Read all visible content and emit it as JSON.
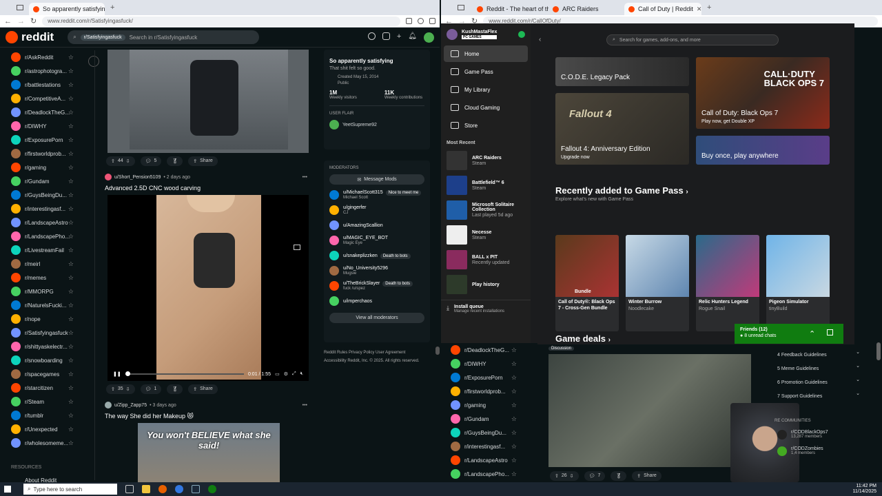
{
  "left_browser": {
    "active_tab": "So apparently satisfying",
    "url": "www.reddit.com/r/Satisfyingasfuck/"
  },
  "right_browser": {
    "tabs": [
      {
        "label": "Reddit - The heart of the intern"
      },
      {
        "label": "ARC Raiders"
      },
      {
        "label": "Call of Duty | Reddit"
      }
    ],
    "url": "www.reddit.com/r/CallOfDuty/"
  },
  "reddit": {
    "logo": "reddit",
    "search_chip": "r/Satisfyingasfuck",
    "search_placeholder": "Search in r/Satisfyingasfuck",
    "sidebar": [
      "r/AskReddit",
      "r/astrophotogra...",
      "r/battlestations",
      "r/CompetitiveA...",
      "r/DeadlockTheG...",
      "r/DIWHY",
      "r/ExposurePorn",
      "r/firstworldprob...",
      "r/gaming",
      "r/Gundam",
      "r/GuysBeingDu...",
      "r/interestingasf...",
      "r/LandscapeAstro",
      "r/LandscapePho...",
      "r/LivestreamFail",
      "r/meirl",
      "r/memes",
      "r/MMORPG",
      "r/NaturelsFucki...",
      "r/nope",
      "r/Satisfyingasfuck",
      "r/shittyaskelectr...",
      "r/snowboarding",
      "r/spacegames",
      "r/starcitizen",
      "r/Steam",
      "r/tumblr",
      "r/Unexpected",
      "r/wholesomeme..."
    ],
    "resources_label": "RESOURCES",
    "about_label": "About Reddit",
    "post1": {
      "votes": "44",
      "comments": "5",
      "share": "Share"
    },
    "post2": {
      "author": "u/Short_Pension5109",
      "age": "• 2 days ago",
      "title": "Advanced 2.5D CNC wood carving",
      "time": "0:01 / 1:55",
      "votes": "35",
      "comments": "1",
      "share": "Share"
    },
    "post3": {
      "author": "u/Zipp_Zapp75",
      "age": "• 3 days ago",
      "title": "The way She did her Makeup 😻",
      "caption": "You won't BELIEVE what she said!"
    },
    "community": {
      "name": "So apparently satisfying",
      "tagline": "That shit felt so good.",
      "created": "Created May 15, 2014",
      "visibility": "Public",
      "visitors": "1M",
      "visitors_label": "Weekly visitors",
      "contrib": "11K",
      "contrib_label": "Weekly contributions",
      "flair_label": "USER FLAIR",
      "flair_user": "YeetSupreme92"
    },
    "mods_label": "MODERATORS",
    "message_mods": "Message Mods",
    "mods": [
      {
        "name": "u/MichaelScott315",
        "sub": "Michael Scott",
        "flair": "Nice to meet me"
      },
      {
        "name": "u/gingerfer",
        "sub": "CJ",
        "flair": ""
      },
      {
        "name": "u/AmazingScallion",
        "sub": "",
        "flair": ""
      },
      {
        "name": "u/MAGIC_EYE_BOT",
        "sub": "Magic Eye",
        "flair": ""
      },
      {
        "name": "u/snakeplizzken",
        "sub": "",
        "flair": "Death to bots"
      },
      {
        "name": "u/No_University5296",
        "sub": "Mugsie",
        "flair": ""
      },
      {
        "name": "u/TheBrickSlayer",
        "sub": "fuck /u/spez",
        "flair": "Death to bots"
      },
      {
        "name": "u/imperchaos",
        "sub": "",
        "flair": ""
      }
    ],
    "view_all": "View all moderators",
    "footer1": "Reddit Rules  Privacy Policy  User Agreement",
    "footer2": "Accessibility  Reddit, Inc. © 2025. All rights reserved."
  },
  "xbox": {
    "user": "KushMastaFlex",
    "badge": "PC GAMES",
    "search": "Search for games, add-ons, and more",
    "nav": [
      "Home",
      "Game Pass",
      "My Library",
      "Cloud Gaming",
      "Store"
    ],
    "most_recent": "Most Recent",
    "recent": [
      {
        "t": "ARC Raiders",
        "s": "Steam"
      },
      {
        "t": "Battlefield™ 6",
        "s": "Steam"
      },
      {
        "t": "Microsoft Solitaire Collection",
        "s": "Last played 5d ago"
      },
      {
        "t": "Necesse",
        "s": "Steam"
      },
      {
        "t": "BALL x PIT",
        "s": "Recently updated"
      },
      {
        "t": "Play history",
        "s": ""
      }
    ],
    "install_queue": "Install queue",
    "install_sub": "Manage recent installations",
    "hero": {
      "cod_legacy": "C.O.D.E. Legacy Pack",
      "bo7_title": "Call of Duty: Black Ops 7",
      "bo7_sub": "Play now, get Double XP",
      "fallout_title": "Fallout 4: Anniversary Edition",
      "fallout_sub": "Upgrade now",
      "buy_once": "Buy once, play anywhere"
    },
    "recently_added": "Recently added to Game Pass",
    "recently_sub": "Explore what's new with Game Pass",
    "games": [
      {
        "t": "Call of Duty®: Black Ops 7 - Cross-Gen Bundle",
        "s": "Bundle"
      },
      {
        "t": "Winter Burrow",
        "s": "Noodlecake"
      },
      {
        "t": "Relic Hunters Legend",
        "s": "Rogue Snail"
      },
      {
        "t": "Pigeon Simulator",
        "s": "tinyBuild"
      }
    ],
    "deals": "Game deals",
    "friends": "Friends (12)",
    "unread": "8 unread chats"
  },
  "right_reddit": {
    "sidebar": [
      "r/DeadlockTheG...",
      "r/DIWHY",
      "r/ExposurePorn",
      "r/firstworldprob...",
      "r/gaming",
      "r/Gundam",
      "r/GuysBeingDu...",
      "r/interestingasf...",
      "r/LandscapeAstro",
      "r/LandscapePho..."
    ],
    "discussion": "Discussion",
    "votes": "26",
    "comments": "7",
    "share": "Share",
    "rules": [
      "4  Feedback Guidelines",
      "5  Meme Guidelines",
      "6  Promotion Guidelines",
      "7  Support Guidelines"
    ],
    "communities_label": "RE COMMUNITIES",
    "communities": [
      {
        "n": "r/CODBlackOps7",
        "m": "13,287 members"
      },
      {
        "n": "r/CODZombies",
        "m": "1,4 members"
      }
    ]
  },
  "taskbar": {
    "search": "Type here to search",
    "time": "11:42 PM",
    "date": "11/14/2025"
  }
}
